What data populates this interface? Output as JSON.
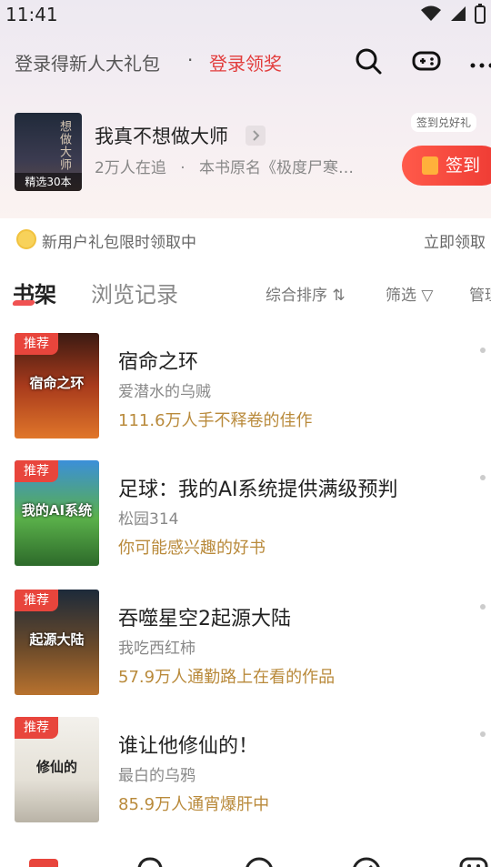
{
  "status": {
    "time": "11:41"
  },
  "header": {
    "promo_text": "登录得新人大礼包",
    "dot": "·",
    "login_label": "登录领奖"
  },
  "featured": {
    "cover_text": "想做大师",
    "cover_badge": "精选30本",
    "title": "我真不想做大师",
    "followers": "2万人在追",
    "sep": "·",
    "original_name": "本书原名《极度尸寒…",
    "checkin_hint": "签到兑好礼",
    "checkin_label": "签到"
  },
  "gift_bar": {
    "text": "新用户礼包限时领取中",
    "action": "立即领取"
  },
  "tabs": {
    "shelf": "书架",
    "history": "浏览记录",
    "sort": "综合排序 ⇅",
    "filter": "筛选 ▽",
    "manage": "管理"
  },
  "books": [
    {
      "tag": "推荐",
      "cover_text": "宿命之环",
      "title": "宿命之环",
      "author": "爱潜水的乌贼",
      "hint": "111.6万人手不释卷的佳作"
    },
    {
      "tag": "推荐",
      "cover_text": "我的AI系统",
      "title": "足球：我的AI系统提供满级预判",
      "author": "松园314",
      "hint": "你可能感兴趣的好书"
    },
    {
      "tag": "推荐",
      "cover_text": "起源大陆",
      "title": "吞噬星空2起源大陆",
      "author": "我吃西红柿",
      "hint": "57.9万人通勤路上在看的作品"
    },
    {
      "tag": "推荐",
      "cover_text": "修仙的",
      "title": "谁让他修仙的！",
      "author": "最白的乌鸦",
      "hint": "85.9万人通宵爆肝中"
    }
  ],
  "colors": {
    "accent": "#e23d3d",
    "hint": "#b98a3b",
    "tag": "#e8453c"
  }
}
